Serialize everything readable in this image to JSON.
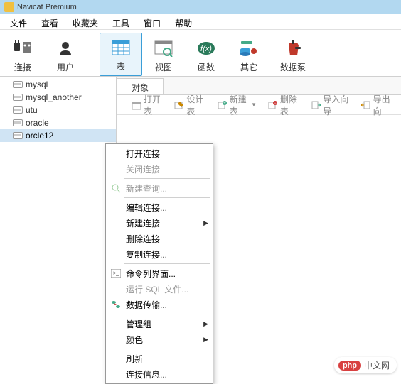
{
  "title": "Navicat Premium",
  "menubar": [
    "文件",
    "查看",
    "收藏夹",
    "工具",
    "窗口",
    "帮助"
  ],
  "toolbar": [
    {
      "label": "连接",
      "icon": "plug"
    },
    {
      "label": "用户",
      "icon": "user"
    },
    {
      "label": "表",
      "icon": "table",
      "active": true
    },
    {
      "label": "视图",
      "icon": "view"
    },
    {
      "label": "函数",
      "icon": "fx"
    },
    {
      "label": "其它",
      "icon": "other"
    },
    {
      "label": "数据泵",
      "icon": "pump"
    }
  ],
  "sidebar": {
    "items": [
      {
        "label": "mysql"
      },
      {
        "label": "mysql_another"
      },
      {
        "label": "utu"
      },
      {
        "label": "oracle"
      },
      {
        "label": "orcle12",
        "selected": true
      }
    ]
  },
  "content": {
    "tab": "对象",
    "actions": [
      {
        "label": "打开表",
        "icon": "open"
      },
      {
        "label": "设计表",
        "icon": "design"
      },
      {
        "label": "新建表",
        "icon": "new",
        "dropdown": true
      },
      {
        "label": "删除表",
        "icon": "delete"
      },
      {
        "label": "导入向导",
        "icon": "import"
      },
      {
        "label": "导出向"
      }
    ]
  },
  "context_menu": [
    {
      "label": "打开连接"
    },
    {
      "label": "关闭连接",
      "disabled": true
    },
    {
      "sep": true
    },
    {
      "label": "新建查询...",
      "icon": "query",
      "disabled": true
    },
    {
      "sep": true
    },
    {
      "label": "编辑连接..."
    },
    {
      "label": "新建连接",
      "submenu": true
    },
    {
      "label": "删除连接"
    },
    {
      "label": "复制连接..."
    },
    {
      "sep": true
    },
    {
      "label": "命令列界面...",
      "icon": "cli"
    },
    {
      "label": "运行 SQL 文件...",
      "disabled": true
    },
    {
      "label": "数据传输...",
      "icon": "transfer"
    },
    {
      "sep": true
    },
    {
      "label": "管理组",
      "submenu": true
    },
    {
      "label": "颜色",
      "submenu": true
    },
    {
      "sep": true
    },
    {
      "label": "刷新"
    },
    {
      "label": "连接信息..."
    }
  ],
  "watermark": {
    "badge": "php",
    "text": "中文网"
  }
}
